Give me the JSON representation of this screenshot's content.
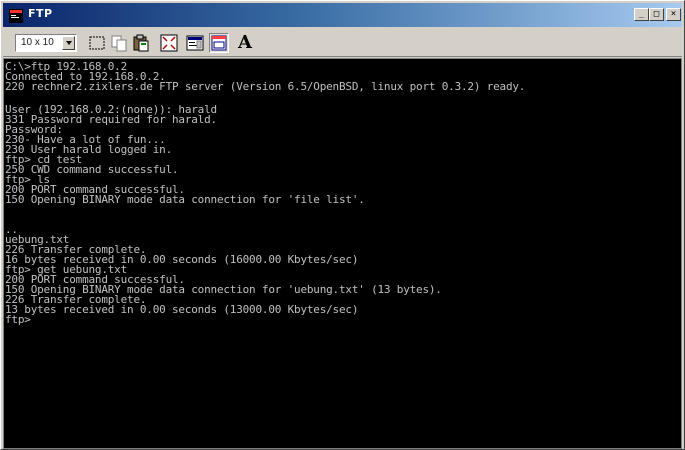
{
  "window": {
    "title": "FTP",
    "min_glyph": "_",
    "max_glyph": "□",
    "close_glyph": "×"
  },
  "toolbar": {
    "font_size_value": "10 x 10",
    "font_button_label": "A",
    "icons": [
      "mark-icon",
      "copy-icon",
      "paste-icon",
      "fullscreen-icon",
      "properties-icon",
      "background-icon",
      "font-icon"
    ]
  },
  "console": {
    "text_color": "#c0c0c0",
    "background_color": "#000000",
    "lines": [
      "C:\\>ftp 192.168.0.2",
      "Connected to 192.168.0.2.",
      "220 rechner2.zixlers.de FTP server (Version 6.5/OpenBSD, linux port 0.3.2) ready.",
      "",
      "User (192.168.0.2:(none)): harald",
      "331 Password required for harald.",
      "Password:",
      "230- Have a lot of fun...",
      "230 User harald logged in.",
      "ftp> cd test",
      "250 CWD command successful.",
      "ftp> ls",
      "200 PORT command successful.",
      "150 Opening BINARY mode data connection for 'file list'.",
      "",
      "",
      "..",
      "uebung.txt",
      "226 Transfer complete.",
      "16 bytes received in 0.00 seconds (16000.00 Kbytes/sec)",
      "ftp> get uebung.txt",
      "200 PORT command successful.",
      "150 Opening BINARY mode data connection for 'uebung.txt' (13 bytes).",
      "226 Transfer complete.",
      "13 bytes received in 0.00 seconds (13000.00 Kbytes/sec)",
      "ftp>"
    ]
  }
}
